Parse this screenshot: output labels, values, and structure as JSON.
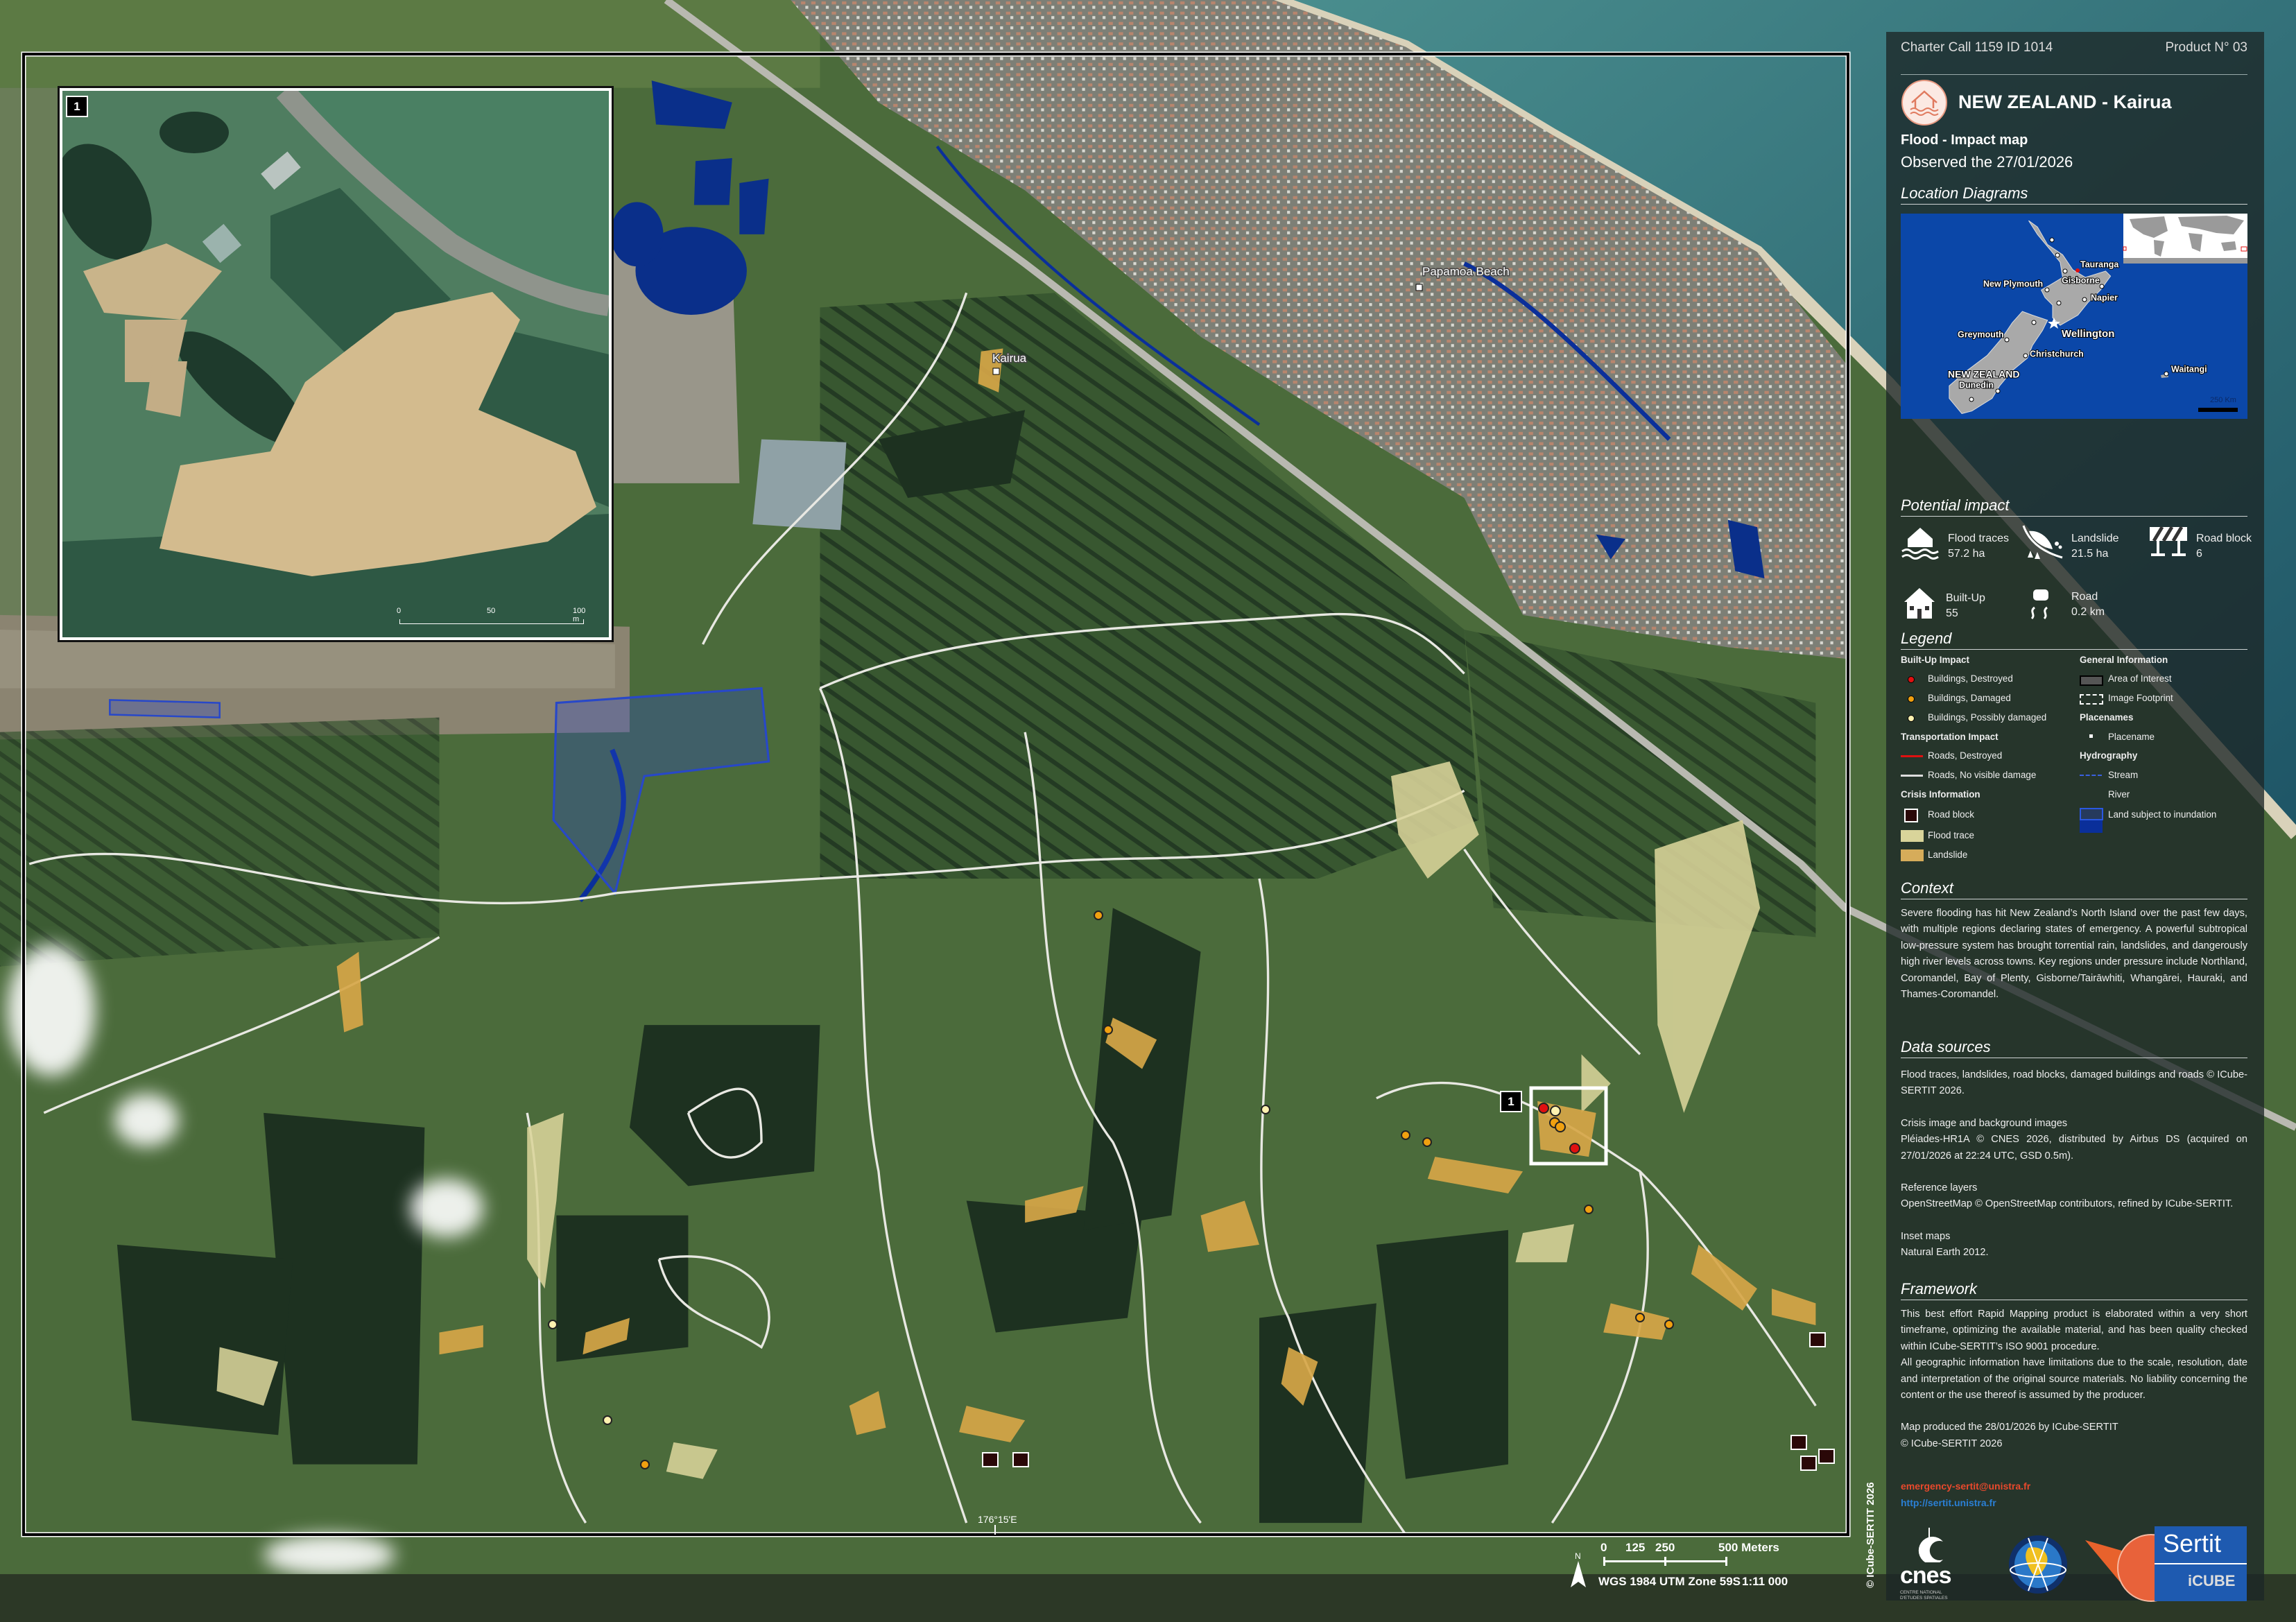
{
  "header": {
    "charter": "Charter Call 1159 ID 1014",
    "product": "Product N° 03"
  },
  "title": {
    "main": "NEW ZEALAND - Kairua",
    "subtitle": "Flood - Impact map",
    "observed": "Observed the 27/01/2026"
  },
  "location_diagrams": {
    "heading": "Location Diagrams",
    "labels": {
      "tauranga": "Tauranga",
      "gisborne": "Gisborne",
      "new_plymouth": "New Plymouth",
      "napier": "Napier",
      "wellington": "Wellington",
      "greymouth": "Greymouth",
      "christchurch": "Christchurch",
      "country": "NEW ZEALAND",
      "dunedin": "Dunedin",
      "waitangi": "Waitangi",
      "scale": "250 Km"
    },
    "colors": {
      "sea": "#0b47a8",
      "land": "#a9a9a9"
    }
  },
  "potential_impact": {
    "heading": "Potential impact",
    "items": [
      {
        "icon": "flooded-house-icon",
        "label": "Flood traces",
        "value": "57.2 ha"
      },
      {
        "icon": "landslide-icon",
        "label": "Landslide",
        "value": "21.5 ha"
      },
      {
        "icon": "road-block-icon",
        "label": "Road block",
        "value": "6"
      },
      {
        "icon": "house-icon",
        "label": "Built-Up",
        "value": "55"
      },
      {
        "icon": "slippery-road-icon",
        "label": "Road",
        "value": "0.2 km"
      }
    ]
  },
  "legend": {
    "heading": "Legend",
    "builtup": {
      "title": "Built-Up Impact",
      "destroyed": "Buildings, Destroyed",
      "damaged": "Buildings, Damaged",
      "possibly": "Buildings, Possibly damaged"
    },
    "transport": {
      "title": "Transportation Impact",
      "destroyed": "Roads, Destroyed",
      "no_damage": "Roads, No visible damage"
    },
    "crisis": {
      "title": "Crisis Information",
      "road_block": "Road block",
      "flood_trace": "Flood trace",
      "landslide": "Landslide"
    },
    "general": {
      "title": "General Information",
      "aoi": "Area of Interest",
      "footprint": "Image Footprint"
    },
    "placenames": {
      "title": "Placenames",
      "placename": "Placename"
    },
    "hydro": {
      "title": "Hydrography",
      "stream": "Stream",
      "river": "River",
      "inundation": "Land subject to inundation"
    },
    "colors": {
      "destroyed": "#e01010",
      "damaged": "#f0a010",
      "possibly": "#fff2b0",
      "flood_trace": "#d9d49a",
      "landslide": "#d6ac5a",
      "river": "#0a2f9a",
      "road_destroyed": "#e01010"
    }
  },
  "context": {
    "heading": "Context",
    "text": "Severe flooding has hit New Zealand’s North Island over the past few days, with multiple regions declaring states of emergency. A powerful subtropical low-pressure system has brought torrential rain, landslides, and dangerously high river levels across towns. Key regions under pressure include Northland, Coromandel, Bay of Plenty, Gisborne/Tairāwhiti, Whangārei, Hauraki, and Thames-Coromandel."
  },
  "data_sources": {
    "heading": "Data sources",
    "p1": "Flood traces, landslides, road blocks, damaged buildings and roads © ICube-SERTIT 2026.",
    "p2_title": "Crisis image and background images",
    "p2": "Pléiades-HR1A © CNES 2026, distributed by Airbus DS (acquired on 27/01/2026 at 22:24 UTC, GSD 0.5m).",
    "p3_title": "Reference layers",
    "p3": "OpenStreetMap © OpenStreetMap contributors, refined by ICube-SERTIT.",
    "p4_title": "Inset maps",
    "p4": "Natural Earth 2012."
  },
  "framework": {
    "heading": "Framework",
    "p1": "This best effort Rapid Mapping product is elaborated within a very short timeframe, optimizing the available material, and has been quality checked within ICube-SERTIT’s ISO 9001 procedure.",
    "p2": "All geographic information have limitations due to the scale, resolution, date and interpretation of the original source materials. No liability concerning the content or the use thereof is assumed by the producer.",
    "produced": "Map produced the 28/01/2026 by ICube-SERTIT",
    "copyright": "© ICube-SERTIT 2026",
    "email": "emergency-sertit@unistra.fr",
    "url": "http://sertit.unistra.fr"
  },
  "logos": {
    "cnes": "cnes",
    "cnes_sub1": "CENTRE NATIONAL",
    "cnes_sub2": "D'ETUDES SPATIALES",
    "sertit": "Sertit",
    "icube": "iCUBE"
  },
  "map": {
    "placenames": {
      "papamoa": "Papamoa Beach",
      "kairua": "Kairua"
    },
    "aoi_number": "1",
    "longitude_label": "176°15'E",
    "vertical_copyright": "© ICube-SERTIT 2026",
    "scale": {
      "ticks": [
        "0",
        "125",
        "250",
        "500 Meters"
      ],
      "projection": "WGS 1984 UTM Zone 59S",
      "ratio": "1:11 000",
      "north": "N"
    }
  },
  "inset": {
    "number": "1",
    "scale_ticks": [
      "0",
      "50",
      "100 m"
    ]
  }
}
